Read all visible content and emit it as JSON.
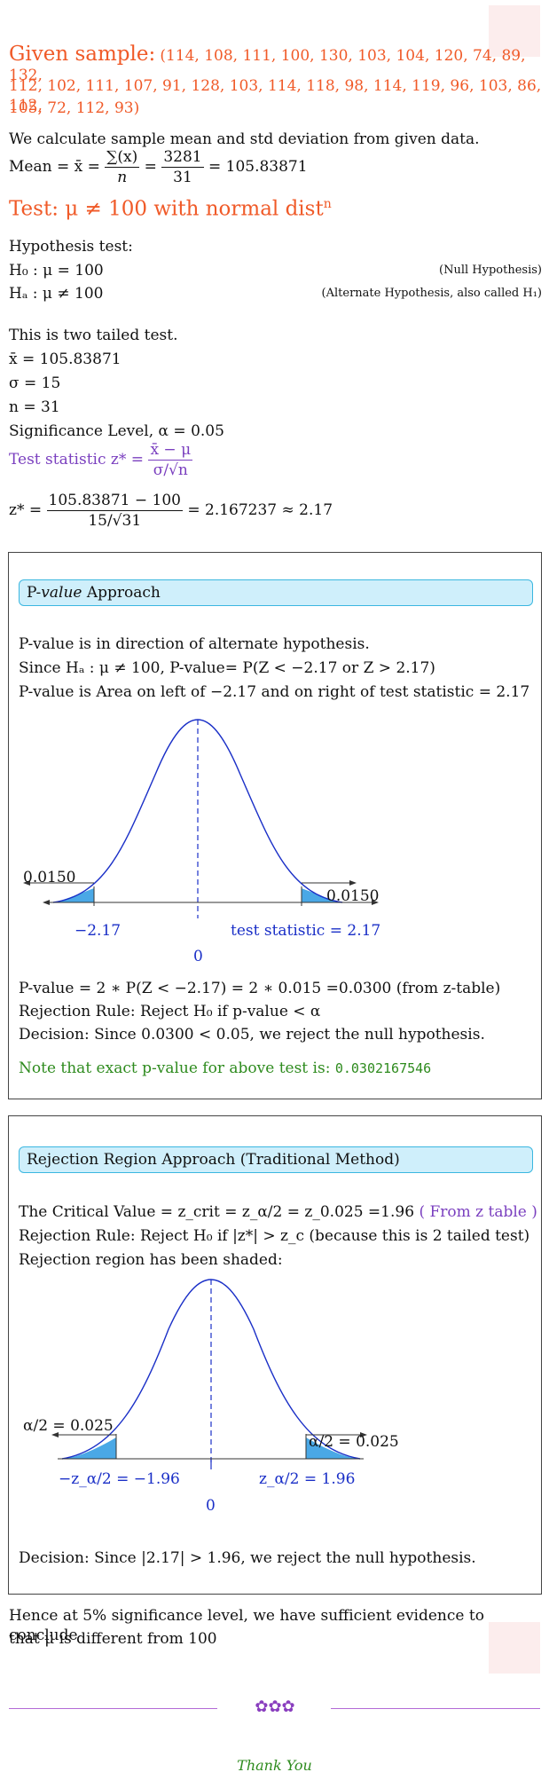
{
  "header": {
    "title": "Given sample:",
    "sample_line1": "(114, 108, 111, 100, 130, 103, 104, 120, 74, 89, 132,",
    "sample_line2": "112, 102, 111, 107, 91, 128, 103, 114, 118, 98, 114, 119, 96, 103, 86, 112,",
    "sample_line3": "105, 72, 112, 93)"
  },
  "intro": {
    "calc_line": "We calculate sample mean and std deviation from given data.",
    "mean_label": "Mean = x̄ =",
    "mean_num": "∑(x)",
    "mean_den": "n",
    "mean_eq": "=",
    "mean_num2": "3281",
    "mean_den2": "31",
    "mean_result": "= 105.83871"
  },
  "test_heading": "Test: μ ≠ 100 with normal dist",
  "test_heading_sup": "n",
  "hypothesis": {
    "label": "Hypothesis test:",
    "h0": "H₀ : μ = 100",
    "h0_note": "(Null Hypothesis)",
    "ha": "Hₐ : μ ≠ 100",
    "ha_note": "(Alternate Hypothesis, also called H₁)"
  },
  "params": {
    "two_tailed": "This is two tailed test.",
    "xbar": "x̄ = 105.83871",
    "sigma": "σ = 15",
    "n": "n = 31",
    "alpha": "Significance Level, α = 0.05"
  },
  "statistic": {
    "label": "Test statistic z* =",
    "num": "x̄ − μ",
    "den": "σ/√n",
    "calc_label": "z* =",
    "calc_num": "105.83871 − 100",
    "calc_den": "15/√31",
    "calc_result": "= 2.167237 ≈ 2.17"
  },
  "pvalue_section": {
    "title_prefix": "P-",
    "title_italic": "value",
    "title_suffix": " Approach",
    "line1": "P-value is in direction of alternate hypothesis.",
    "line2": "Since Hₐ : μ ≠ 100, P-value= P(Z < −2.17 or Z > 2.17)",
    "line3": "P-value is Area on left of −2.17 and on right of test statistic = 2.17",
    "left_area": "0.0150",
    "right_area": "0.0150",
    "left_tick": "−2.17",
    "center_tick": "0",
    "right_tick": "test statistic = 2.17",
    "result": "P-value = 2 ∗ P(Z < −2.17) = 2 ∗ 0.015 =0.0300 (from z-table)",
    "rule": "Rejection Rule: Reject H₀ if p-value < α",
    "decision": "Decision: Since 0.0300 < 0.05, we reject the null hypothesis.",
    "note": "Note that exact p-value for above test is:",
    "exact": "0.0302167546"
  },
  "rejection_section": {
    "title": "Rejection Region Approach (Traditional Method)",
    "critical": "The Critical Value = z_crit = z_α/2 = z_0.025 =1.96",
    "critical_src": "( From z table )",
    "rule": "Rejection Rule: Reject H₀ if |z*| > z_c (because this is 2 tailed test)",
    "shaded": "Rejection region has been shaded:",
    "left_area": "α/2 = 0.025",
    "right_area": "α/2 = 0.025",
    "left_tick": "−z_α/2 = −1.96",
    "center_tick": "0",
    "right_tick": "z_α/2 = 1.96",
    "decision": "Decision: Since |2.17| > 1.96, we reject the null hypothesis."
  },
  "conclusion": {
    "line1": "Hence at 5% significance level, we have sufficient evidence to conclude",
    "line2": "that μ is different from 100"
  },
  "footer": {
    "thanks": "Thank You",
    "ornament": "✿✿✿"
  },
  "colors": {
    "accent": "#f05a28",
    "purple": "#7a3fbf",
    "curve": "#1a2fc7",
    "shade": "#4aa8e6",
    "banner": "#cfeffb",
    "green": "#2e8b1e"
  }
}
